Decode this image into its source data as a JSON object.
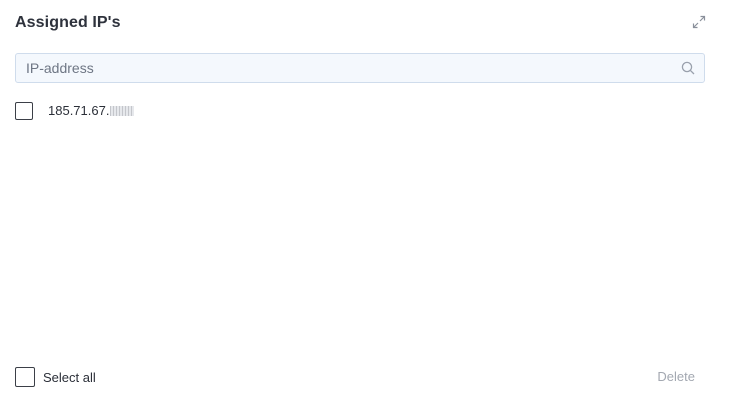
{
  "header": {
    "title": "Assigned IP's"
  },
  "toolbar": {
    "expand_icon": "expand-icon"
  },
  "search": {
    "placeholder": "IP-address",
    "value": "",
    "icon": "search-icon"
  },
  "ip_list": {
    "items": [
      {
        "address_visible": "185.71.67.",
        "checked": false
      }
    ]
  },
  "footer": {
    "select_all_label": "Select all",
    "delete_label": "Delete",
    "delete_enabled": false
  },
  "colors": {
    "search_bg": "#f4f8fd",
    "search_border": "#cfdcec",
    "disabled_text": "#a3a8b1",
    "text": "#2b2f38"
  }
}
